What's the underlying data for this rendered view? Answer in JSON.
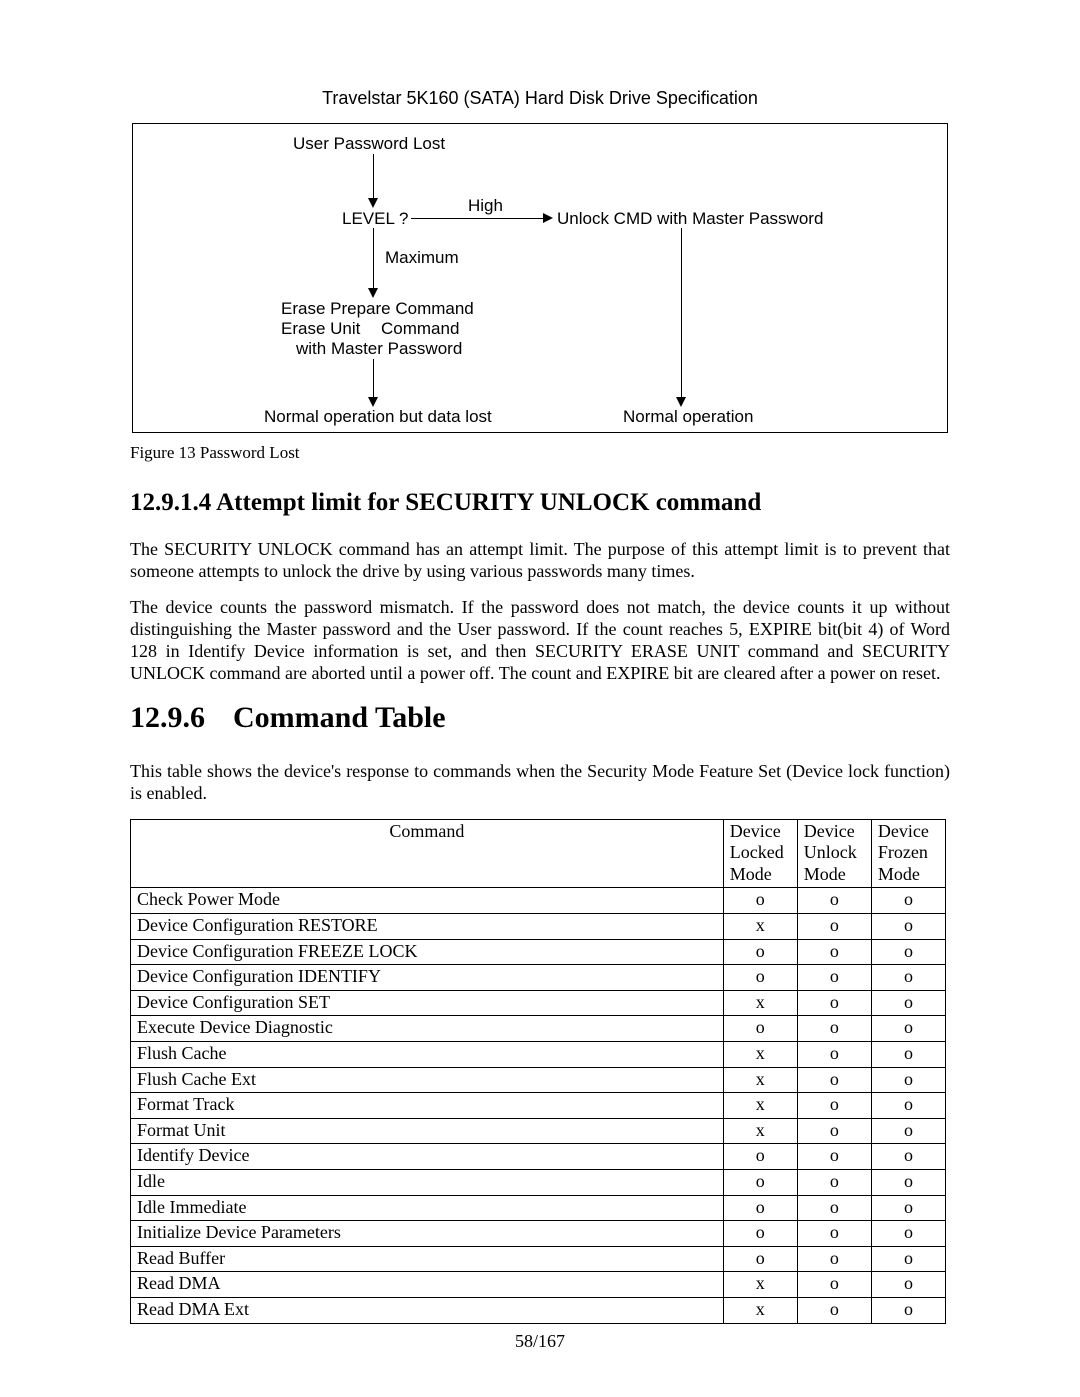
{
  "header": {
    "title": "Travelstar 5K160 (SATA) Hard Disk Drive Specification"
  },
  "diagram": {
    "userPwdLost": "User Password Lost",
    "level": "LEVEL ?",
    "high": "High",
    "unlockMaster": "Unlock CMD with Master Password",
    "maximum": "Maximum",
    "erasePrep": "Erase Prepare Command",
    "eraseUnit1": "Erase Unit",
    "eraseUnit2": "Command",
    "withMaster": "with Master Password",
    "normalLost": "Normal operation but data lost",
    "normalOp": "Normal operation"
  },
  "figure_caption": "Figure 13 Password Lost",
  "sections": {
    "s1_num": "12.9.1.4",
    "s1_title": "Attempt limit for SECURITY UNLOCK command",
    "s1_p1": "The SECURITY UNLOCK command has an attempt limit. The purpose of this attempt limit is to prevent that someone attempts to unlock the drive by using various passwords many times.",
    "s1_p2": "The device counts the password mismatch. If the password does not match, the device counts it up without distinguishing the Master password and the User password. If the count reaches 5, EXPIRE bit(bit 4) of Word 128 in Identify Device information is set, and then SECURITY ERASE UNIT command and SECURITY UNLOCK command are aborted until a power off. The count and EXPIRE bit are cleared after a power on reset.",
    "s2_num": "12.9.6",
    "s2_title": "Command Table",
    "s2_p1": "This table shows the device's response to commands when the Security Mode Feature Set (Device lock function) is enabled."
  },
  "table": {
    "headers": {
      "c1": "Command",
      "c2a": "Device",
      "c2b": "Locked",
      "c2c": "Mode",
      "c3a": "Device",
      "c3b": "Unlock",
      "c3c": "Mode",
      "c4a": "Device",
      "c4b": "Frozen",
      "c4c": "Mode"
    },
    "rows": [
      {
        "cmd": "Check Power Mode",
        "a": "o",
        "b": "o",
        "c": "o"
      },
      {
        "cmd": "Device Configuration RESTORE",
        "a": "x",
        "b": "o",
        "c": "o"
      },
      {
        "cmd": "Device Configuration FREEZE LOCK",
        "a": "o",
        "b": "o",
        "c": "o"
      },
      {
        "cmd": "Device Configuration IDENTIFY",
        "a": "o",
        "b": "o",
        "c": "o"
      },
      {
        "cmd": "Device Configuration SET",
        "a": "x",
        "b": "o",
        "c": "o"
      },
      {
        "cmd": "Execute Device Diagnostic",
        "a": "o",
        "b": "o",
        "c": "o"
      },
      {
        "cmd": "Flush Cache",
        "a": "x",
        "b": "o",
        "c": "o"
      },
      {
        "cmd": "Flush Cache Ext",
        "a": "x",
        "b": "o",
        "c": "o"
      },
      {
        "cmd": "Format Track",
        "a": "x",
        "b": "o",
        "c": "o"
      },
      {
        "cmd": "Format Unit",
        "a": "x",
        "b": "o",
        "c": "o"
      },
      {
        "cmd": "Identify Device",
        "a": "o",
        "b": "o",
        "c": "o"
      },
      {
        "cmd": "Idle",
        "a": "o",
        "b": "o",
        "c": "o"
      },
      {
        "cmd": "Idle Immediate",
        "a": "o",
        "b": "o",
        "c": "o"
      },
      {
        "cmd": "Initialize Device Parameters",
        "a": "o",
        "b": "o",
        "c": "o"
      },
      {
        "cmd": "Read Buffer",
        "a": "o",
        "b": "o",
        "c": "o"
      },
      {
        "cmd": "Read DMA",
        "a": "x",
        "b": "o",
        "c": "o"
      },
      {
        "cmd": "Read DMA Ext",
        "a": "x",
        "b": "o",
        "c": "o"
      }
    ]
  },
  "page_number": "58/167"
}
